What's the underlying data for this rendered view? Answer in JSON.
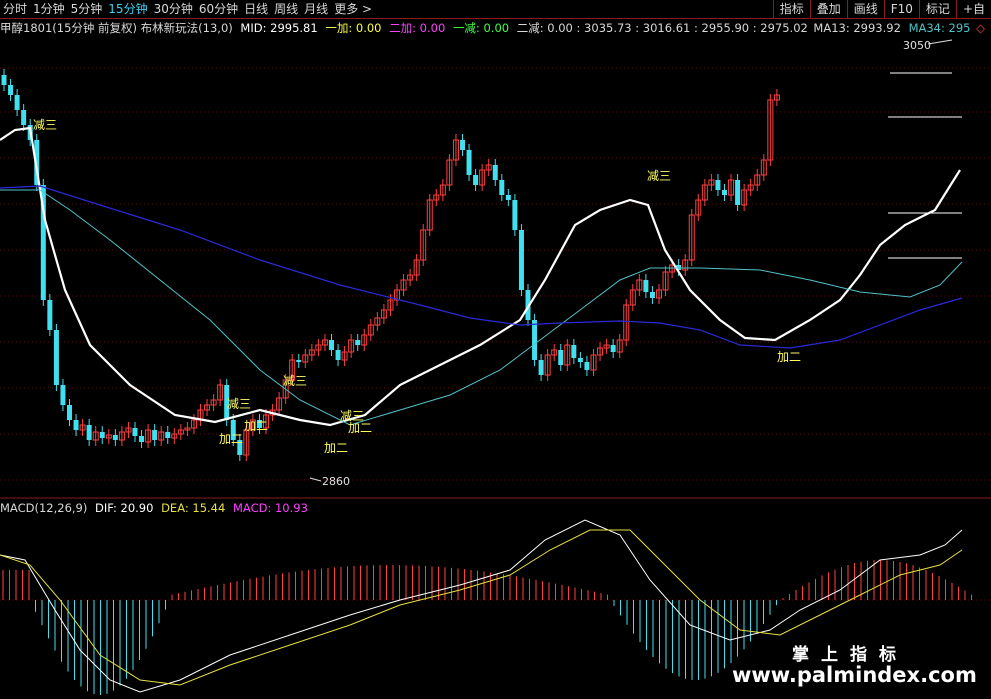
{
  "toolbar": {
    "periods": [
      "分时",
      "1分钟",
      "5分钟",
      "15分钟",
      "30分钟",
      "60分钟",
      "日线",
      "周线",
      "月线",
      "更多 >"
    ],
    "active_period": "15分钟",
    "tools": [
      "指标",
      "叠加",
      "画线",
      "F10",
      "标记",
      "+自"
    ]
  },
  "info": {
    "title": "甲醇1801(15分钟 前复权) 布林新玩法(13,0)",
    "mid": "MID: 2995.81",
    "add1": "一加: 0.00",
    "add2": "二加: 0.00",
    "sub1": "一减: 0.00",
    "sub2": "二减: 0.00 : 3035.73 : 3016.61 : 2955.90 : 2975.02",
    "ma13": "MA13: 2993.92",
    "ma34": "MA34: 295",
    "ma34_marker": "◇"
  },
  "annotations": {
    "high_label": "3050",
    "low_label": "2860",
    "signals": [
      {
        "text": "减三"
      },
      {
        "text": "减三"
      },
      {
        "text": "减三"
      },
      {
        "text": "减三"
      },
      {
        "text": "减三"
      },
      {
        "text": "加二"
      },
      {
        "text": "加二"
      },
      {
        "text": "加二"
      },
      {
        "text": "加二"
      },
      {
        "text": "加二"
      }
    ]
  },
  "macd": {
    "label": "MACD(12,26,9)",
    "dif": "DIF: 20.90",
    "dea": "DEA: 15.44",
    "macd": "MACD: 10.93"
  },
  "watermark": {
    "cn": "掌上指标",
    "url": "www.palmindex.com"
  },
  "colors": {
    "up": "#ff4040",
    "down": "#40e0f0",
    "mid_line": "#ffffff",
    "ma13": "#4fc3c8",
    "ma34": "#2a2ad8",
    "dif": "#ffffff",
    "dea": "#e8e040",
    "macd_text": "#ff40ff",
    "add1": "#ffff40",
    "add2": "#ff40ff",
    "sub1": "#40ff40",
    "signal": "#ffff60"
  }
}
